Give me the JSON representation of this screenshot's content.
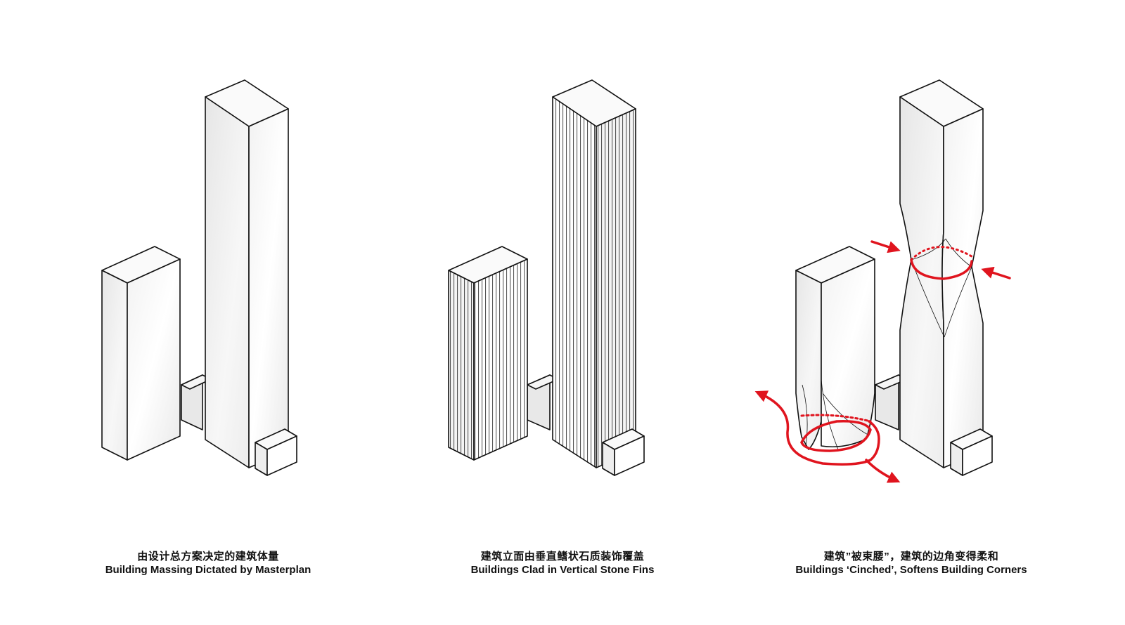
{
  "panels": [
    {
      "caption_zh": "由设计总方案决定的建筑体量",
      "caption_en": "Building Massing Dictated by Masterplan"
    },
    {
      "caption_zh": "建筑立面由垂直鳍状石质装饰覆盖",
      "caption_en": "Buildings Clad in Vertical Stone Fins"
    },
    {
      "caption_zh": "建筑”被束腰”，建筑的边角变得柔和",
      "caption_en": "Buildings ‘Cinched’, Softens Building Corners"
    }
  ],
  "colors": {
    "outline": "#111111",
    "face_light": "#f6f6f6",
    "face_mid": "#ececec",
    "face_dark": "#e2e2e2",
    "accent_red": "#e0141e"
  }
}
